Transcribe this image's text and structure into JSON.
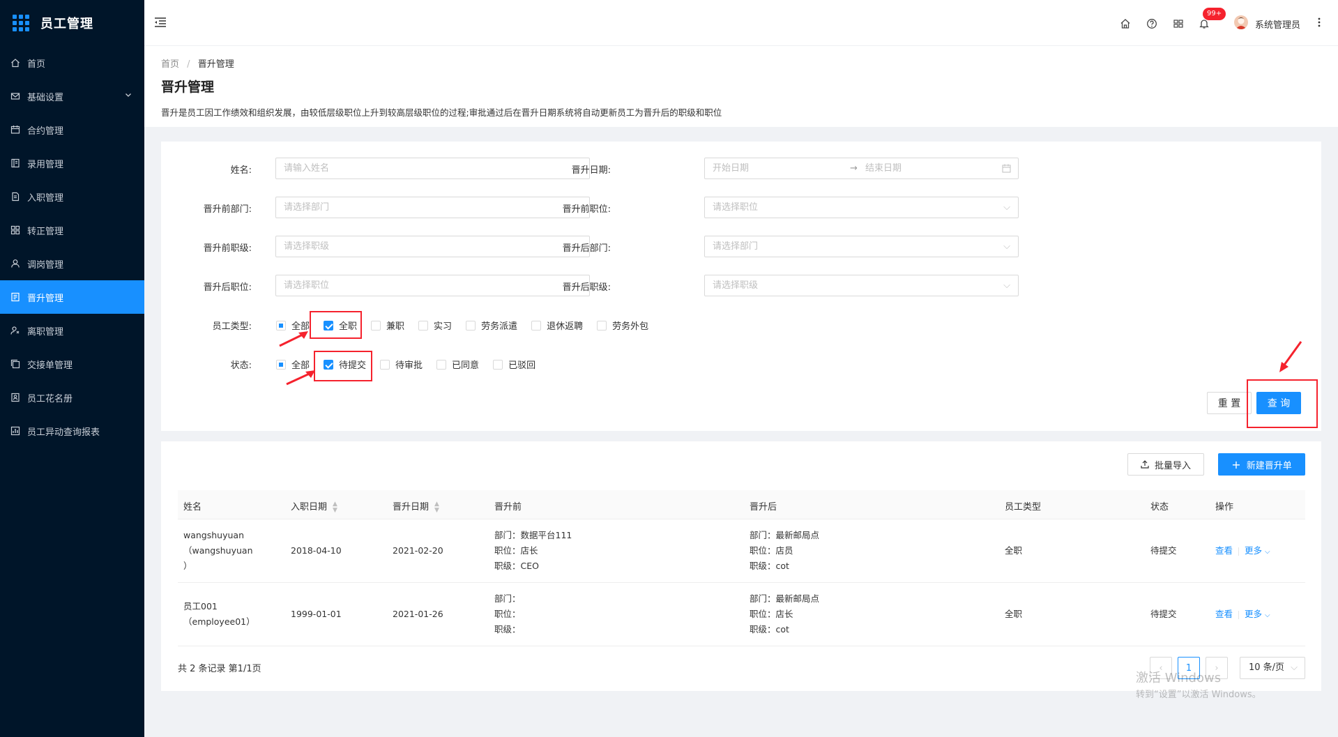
{
  "app": {
    "title": "员工管理",
    "accent": "#1890ff",
    "sidebar_bg": "#001529"
  },
  "sidebar": {
    "items": [
      {
        "label": "首页",
        "icon": "home-icon"
      },
      {
        "label": "基础设置",
        "icon": "mail-icon"
      },
      {
        "label": "合约管理",
        "icon": "calendar-icon"
      },
      {
        "label": "录用管理",
        "icon": "book-icon"
      },
      {
        "label": "入职管理",
        "icon": "document-icon"
      },
      {
        "label": "转正管理",
        "icon": "grid-icon"
      },
      {
        "label": "调岗管理",
        "icon": "user-icon"
      },
      {
        "label": "晋升管理",
        "icon": "form-icon"
      },
      {
        "label": "离职管理",
        "icon": "user-leave-icon"
      },
      {
        "label": "交接单管理",
        "icon": "copy-icon"
      },
      {
        "label": "员工花名册",
        "icon": "roster-icon"
      },
      {
        "label": "员工异动查询报表",
        "icon": "report-icon"
      }
    ],
    "active_index": 7
  },
  "header": {
    "badge": "99+",
    "user_name": "系统管理员"
  },
  "breadcrumb": {
    "home": "首页",
    "current": "晋升管理"
  },
  "page": {
    "title": "晋升管理",
    "desc": "晋升是员工因工作绩效和组织发展，由较低层级职位上升到较高层级职位的过程;审批通过后在晋升日期系统将自动更新员工为晋升后的职级和职位"
  },
  "filters": {
    "name_label": "姓名:",
    "name_placeholder": "请输入姓名",
    "date_label": "晋升日期:",
    "date_start": "开始日期",
    "date_end": "结束日期",
    "before_dept_label": "晋升前部门:",
    "before_dept_placeholder": "请选择部门",
    "before_pos_label": "晋升前职位:",
    "before_pos_placeholder": "请选择职位",
    "before_level_label": "晋升前职级:",
    "before_level_placeholder": "请选择职级",
    "after_dept_label": "晋升后部门:",
    "after_dept_placeholder": "请选择部门",
    "after_pos_label": "晋升后职位:",
    "after_pos_placeholder": "请选择职位",
    "after_level_label": "晋升后职级:",
    "after_level_placeholder": "请选择职级",
    "emp_type_label": "员工类型:",
    "emp_types": [
      "全部",
      "全职",
      "兼职",
      "实习",
      "劳务派遣",
      "退休返聘",
      "劳务外包"
    ],
    "status_label": "状态:",
    "statuses": [
      "全部",
      "待提交",
      "待审批",
      "已同意",
      "已驳回"
    ],
    "reset": "重 置",
    "query": "查 询"
  },
  "table": {
    "import_btn": "批量导入",
    "new_btn": "新建晋升单",
    "columns": [
      "姓名",
      "入职日期",
      "晋升日期",
      "晋升前",
      "晋升后",
      "员工类型",
      "状态",
      "操作"
    ],
    "rows": [
      {
        "name1": "wangshuyuan",
        "name2": "（wangshuyuan",
        "name3": "）",
        "hire_date": "2018-04-10",
        "promo_date": "2021-02-20",
        "before": [
          "部门：数据平台111",
          "职位：店长",
          "职级：CEO"
        ],
        "after": [
          "部门：最新邮局点",
          "职位：店员",
          "职级：cot"
        ],
        "type": "全职",
        "status": "待提交"
      },
      {
        "name1": "员工001",
        "name2": "（employee01）",
        "name3": "",
        "hire_date": "1999-01-01",
        "promo_date": "2021-01-26",
        "before": [
          "部门：",
          "职位：",
          "职级："
        ],
        "after": [
          "部门：最新邮局点",
          "职位：店长",
          "职级：cot"
        ],
        "type": "全职",
        "status": "待提交"
      }
    ],
    "view": "查看",
    "more": "更多",
    "total": "共 2 条记录 第1/1页",
    "page": "1",
    "page_size": "10 条/页"
  },
  "watermark": {
    "line1": "激活 Windows",
    "line2": "转到“设置”以激活 Windows。"
  }
}
